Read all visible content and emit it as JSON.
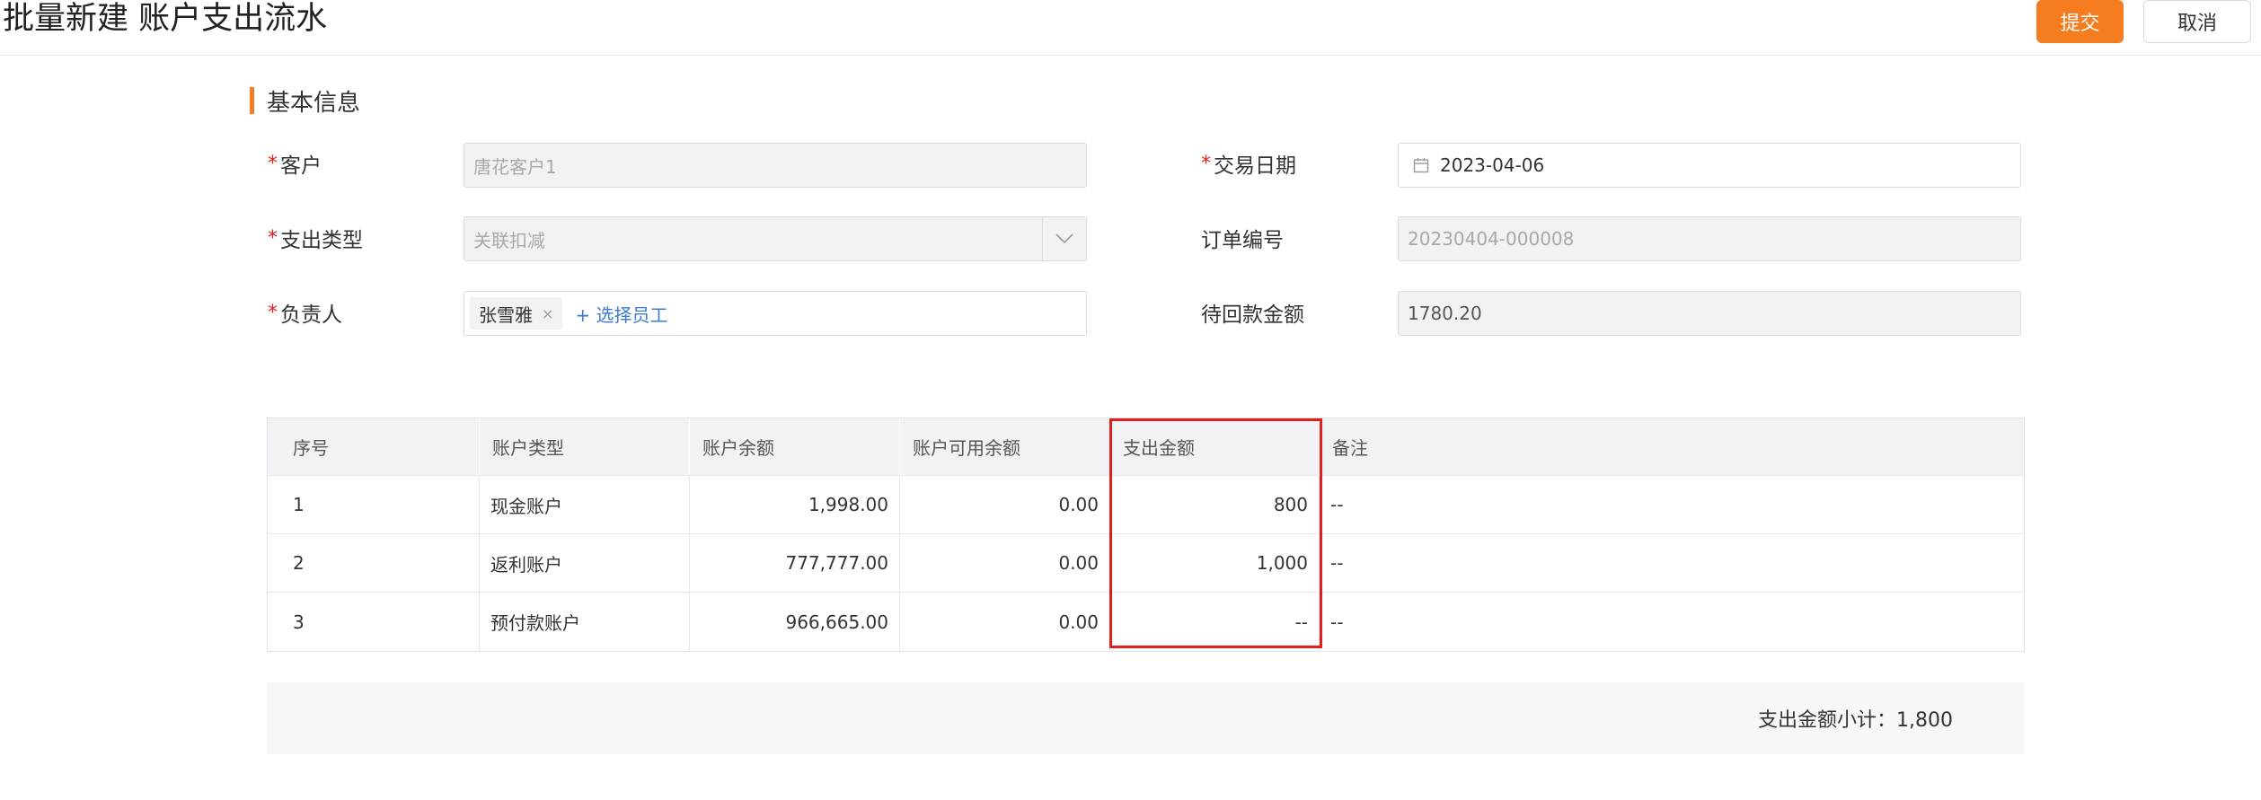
{
  "header": {
    "title": "批量新建 账户支出流水",
    "submit_label": "提交",
    "cancel_label": "取消"
  },
  "section": {
    "title": "基本信息"
  },
  "form": {
    "customer": {
      "label": "客户",
      "required": true,
      "value": "唐花客户1"
    },
    "trade_date": {
      "label": "交易日期",
      "required": true,
      "value": "2023-04-06"
    },
    "expense_type": {
      "label": "支出类型",
      "required": true,
      "value": "关联扣减"
    },
    "order_no": {
      "label": "订单编号",
      "required": false,
      "value": "20230404-000008"
    },
    "owner": {
      "label": "负责人",
      "required": true,
      "tag": "张雪雅",
      "tag_close": "×",
      "add_label": "+ 选择员工"
    },
    "pending_amount": {
      "label": "待回款金额",
      "required": false,
      "value": "1780.20"
    }
  },
  "table": {
    "headers": [
      "序号",
      "账户类型",
      "账户余额",
      "账户可用余额",
      "支出金额",
      "备注"
    ],
    "rows": [
      [
        "1",
        "现金账户",
        "1,998.00",
        "0.00",
        "800",
        "--"
      ],
      [
        "2",
        "返利账户",
        "777,777.00",
        "0.00",
        "1,000",
        "--"
      ],
      [
        "3",
        "预付款账户",
        "966,665.00",
        "0.00",
        "--",
        "--"
      ]
    ]
  },
  "summary": {
    "text": "支出金额小计：1,800"
  },
  "colors": {
    "accent": "#f57c1f",
    "required": "#e02020",
    "link": "#3a7bd5",
    "highlight": "#e02020"
  }
}
